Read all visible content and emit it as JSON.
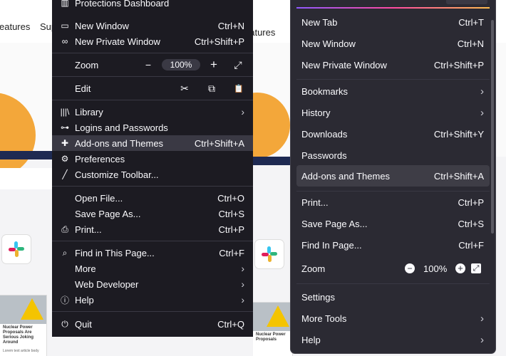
{
  "background_left": {
    "nav_text_1": "eatures",
    "nav_text_2": "Sup"
  },
  "background_right": {
    "nav_text": "eatures"
  },
  "old_menu": {
    "top_item": "Protections Dashboard",
    "items_1": [
      {
        "label": "New Window",
        "shortcut": "Ctrl+N",
        "icon": "window-icon"
      },
      {
        "label": "New Private Window",
        "shortcut": "Ctrl+Shift+P",
        "icon": "private-mask-icon"
      }
    ],
    "zoom": {
      "label": "Zoom",
      "minus": "−",
      "value": "100%",
      "plus": "+",
      "fullscreen": "⤢"
    },
    "edit": {
      "label": "Edit",
      "cut": "✂",
      "copy": "⧉",
      "paste": "📋"
    },
    "items_2": [
      {
        "label": "Library",
        "icon": "library-icon",
        "arrow": "›"
      },
      {
        "label": "Logins and Passwords",
        "icon": "key-icon"
      },
      {
        "label": "Add-ons and Themes",
        "shortcut": "Ctrl+Shift+A",
        "icon": "puzzle-icon"
      },
      {
        "label": "Preferences",
        "icon": "gear-icon"
      },
      {
        "label": "Customize Toolbar...",
        "icon": "brush-icon"
      }
    ],
    "items_3": [
      {
        "label": "Open File...",
        "shortcut": "Ctrl+O"
      },
      {
        "label": "Save Page As...",
        "shortcut": "Ctrl+S"
      },
      {
        "label": "Print...",
        "shortcut": "Ctrl+P",
        "icon": "printer-icon"
      }
    ],
    "items_4": [
      {
        "label": "Find in This Page...",
        "shortcut": "Ctrl+F",
        "icon": "magnifier-icon"
      },
      {
        "label": "More",
        "arrow": "›"
      },
      {
        "label": "Web Developer",
        "arrow": "›"
      },
      {
        "label": "Help",
        "arrow": "›",
        "icon": "help-icon"
      }
    ],
    "quit": {
      "label": "Quit",
      "shortcut": "Ctrl+Q",
      "icon": "power-icon"
    }
  },
  "new_menu": {
    "group_1": [
      {
        "label": "New Tab",
        "shortcut": "Ctrl+T"
      },
      {
        "label": "New Window",
        "shortcut": "Ctrl+N"
      },
      {
        "label": "New Private Window",
        "shortcut": "Ctrl+Shift+P"
      }
    ],
    "group_2": [
      {
        "label": "Bookmarks",
        "arrow": "›"
      },
      {
        "label": "History",
        "arrow": "›"
      },
      {
        "label": "Downloads",
        "shortcut": "Ctrl+Shift+Y"
      },
      {
        "label": "Passwords"
      },
      {
        "label": "Add-ons and Themes",
        "shortcut": "Ctrl+Shift+A"
      }
    ],
    "group_3": [
      {
        "label": "Print...",
        "shortcut": "Ctrl+P"
      },
      {
        "label": "Save Page As...",
        "shortcut": "Ctrl+S"
      },
      {
        "label": "Find In Page...",
        "shortcut": "Ctrl+F"
      }
    ],
    "zoom": {
      "label": "Zoom",
      "minus": "−",
      "value": "100%",
      "plus": "+",
      "fullscreen": "⤢"
    },
    "group_4": [
      {
        "label": "Settings"
      },
      {
        "label": "More Tools",
        "arrow": "›"
      },
      {
        "label": "Help",
        "arrow": "›"
      }
    ]
  },
  "colors": {
    "menu_old_bg": "#1c1b22",
    "menu_new_bg": "#2b2a33",
    "accent_sun": "#f3a73a",
    "page_dark_bar": "#1e2a52"
  }
}
